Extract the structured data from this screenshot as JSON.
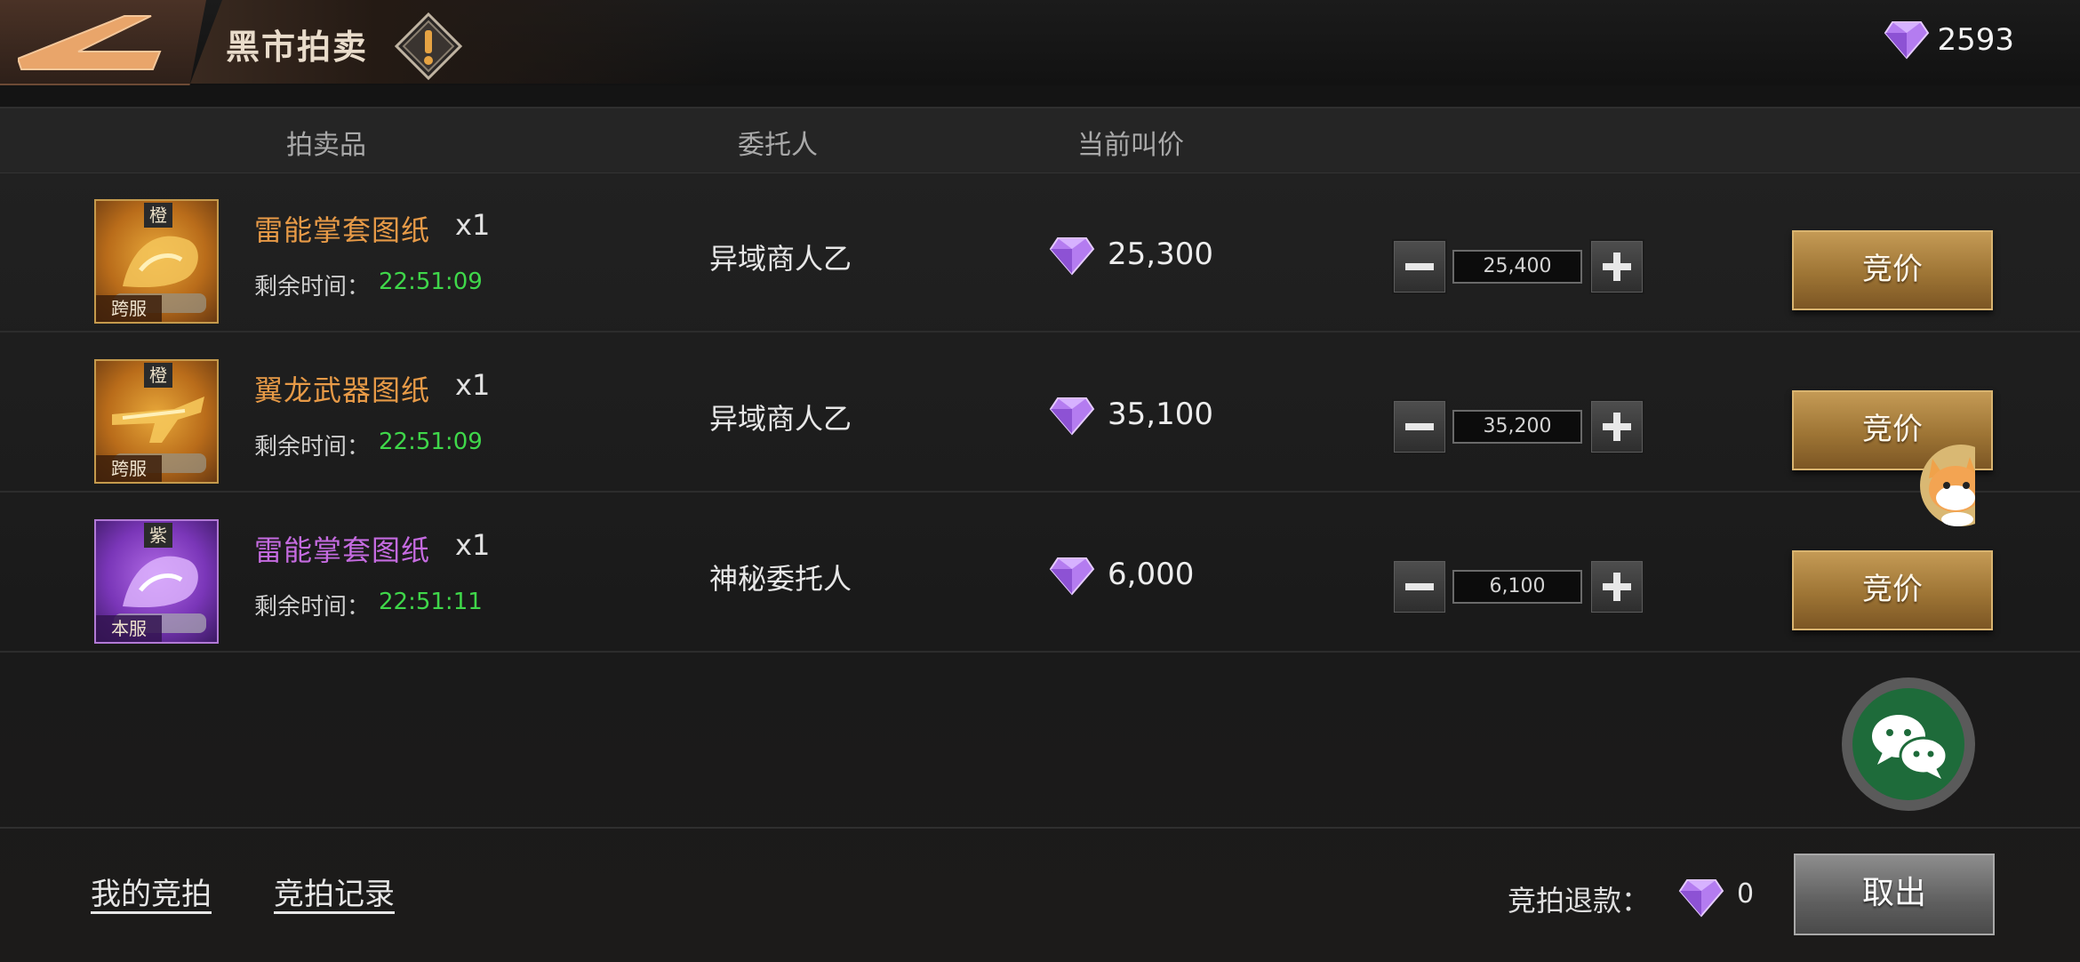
{
  "header": {
    "title": "黑市拍卖",
    "diamonds": "2593"
  },
  "columns": {
    "item": "拍卖品",
    "consigner": "委托人",
    "current_bid": "当前叫价"
  },
  "rows": [
    {
      "grade": "橙",
      "server": "跨服",
      "name": "雷能掌套图纸",
      "qty": "x1",
      "time_label": "剩余时间：",
      "time": "22:51:09",
      "consigner": "异域商人乙",
      "price": "25,300",
      "bid_value": "25,400",
      "bid_label": "竞价"
    },
    {
      "grade": "橙",
      "server": "跨服",
      "name": "翼龙武器图纸",
      "qty": "x1",
      "time_label": "剩余时间：",
      "time": "22:51:09",
      "consigner": "异域商人乙",
      "price": "35,100",
      "bid_value": "35,200",
      "bid_label": "竞价"
    },
    {
      "grade": "紫",
      "server": "本服",
      "name": "雷能掌套图纸",
      "qty": "x1",
      "time_label": "剩余时间：",
      "time": "22:51:11",
      "consigner": "神秘委托人",
      "price": "6,000",
      "bid_value": "6,100",
      "bid_label": "竞价"
    }
  ],
  "footer": {
    "my_bids": "我的竞拍",
    "bid_history": "竞拍记录",
    "refund_label": "竞拍退款：",
    "refund_value": "0",
    "withdraw": "取出"
  },
  "icons": {
    "currency": "diamond-icon",
    "back": "back-arrow-icon",
    "info": "exclamation-diamond-icon",
    "chat": "wechat-icon",
    "assistant": "cat-avatar-icon"
  },
  "colors": {
    "orange_item": "#e79a47",
    "purple_item": "#c56be0",
    "timer_green": "#3fd74a",
    "bid_gold": "#b08443",
    "diamond_purple": "#b47cf0"
  }
}
